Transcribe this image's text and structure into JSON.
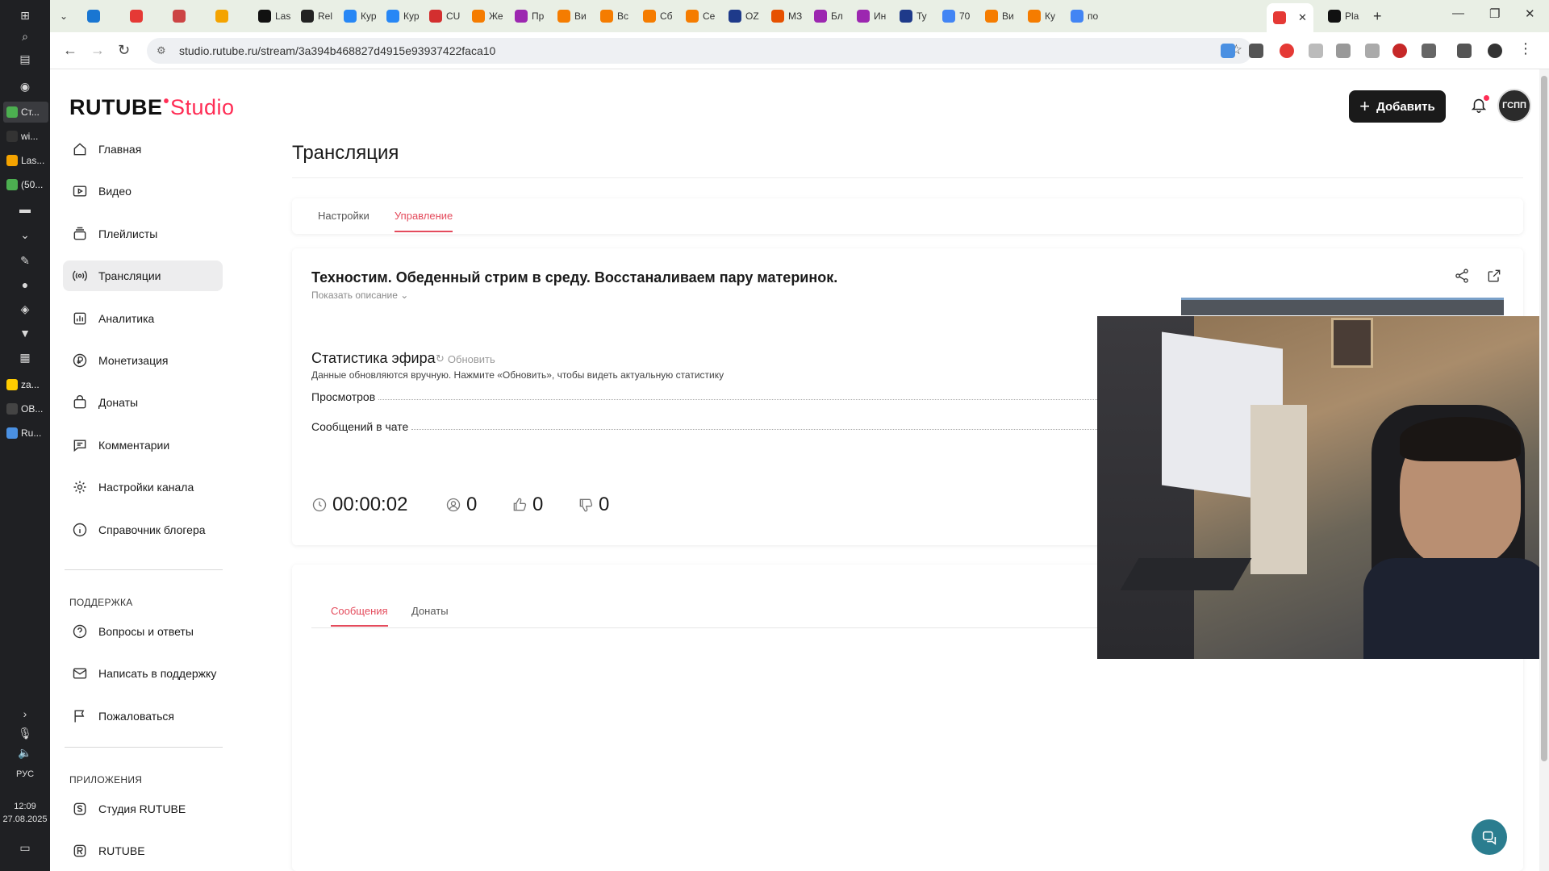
{
  "browser": {
    "tabs": [
      {
        "label": "",
        "color": "#1976d2"
      },
      {
        "label": "",
        "color": "#e53935"
      },
      {
        "label": "",
        "color": "#cc4444"
      },
      {
        "label": "",
        "color": "#f4a300"
      },
      {
        "label": "Las",
        "color": "#111111"
      },
      {
        "label": "Rel",
        "color": "#222222"
      },
      {
        "label": "Кур",
        "color": "#2787f5"
      },
      {
        "label": "Кур",
        "color": "#2787f5"
      },
      {
        "label": "CU",
        "color": "#d32f2f"
      },
      {
        "label": "Же",
        "color": "#f57c00"
      },
      {
        "label": "Пр",
        "color": "#9c27b0"
      },
      {
        "label": "Ви",
        "color": "#f57c00"
      },
      {
        "label": "Вс",
        "color": "#f57c00"
      },
      {
        "label": "Сб",
        "color": "#f57c00"
      },
      {
        "label": "Се",
        "color": "#f57c00"
      },
      {
        "label": "OZ",
        "color": "#1e3a8a"
      },
      {
        "label": "МЗ",
        "color": "#e65100"
      },
      {
        "label": "Бл",
        "color": "#9c27b0"
      },
      {
        "label": "Ин",
        "color": "#9c27b0"
      },
      {
        "label": "Ту",
        "color": "#1e3a8a"
      },
      {
        "label": "70",
        "color": "#4285f4"
      },
      {
        "label": "Ви",
        "color": "#f57c00"
      },
      {
        "label": "Ку",
        "color": "#f57c00"
      },
      {
        "label": "по",
        "color": "#4285f4"
      }
    ],
    "active_tab": {
      "label": "",
      "color": "#e53935"
    },
    "last_tab": {
      "label": "Pla",
      "color": "#111111"
    },
    "url": "studio.rutube.ru/stream/3a394b468827d4915e93937422faca10"
  },
  "taskbar": {
    "apps": [
      "Ст...",
      "wi...",
      "Las...",
      "(50...",
      "za...",
      "OB...",
      "Ru..."
    ],
    "lang": "РУС",
    "time": "12:09",
    "date": "27.08.2025"
  },
  "brand": {
    "name": "RUTUBE",
    "suffix": "Studio",
    "accent": "#ff2d55"
  },
  "header": {
    "add_label": "Добавить",
    "avatar_text": "ГСПП"
  },
  "sidebar": {
    "items": [
      {
        "label": "Главная",
        "icon": "home-icon"
      },
      {
        "label": "Видео",
        "icon": "video-icon"
      },
      {
        "label": "Плейлисты",
        "icon": "playlist-icon"
      },
      {
        "label": "Трансляции",
        "icon": "broadcast-icon"
      },
      {
        "label": "Аналитика",
        "icon": "analytics-icon"
      },
      {
        "label": "Монетизация",
        "icon": "monetization-icon"
      },
      {
        "label": "Донаты",
        "icon": "donations-icon"
      },
      {
        "label": "Комментарии",
        "icon": "comments-icon"
      },
      {
        "label": "Настройки канала",
        "icon": "gear-icon"
      },
      {
        "label": "Справочник блогера",
        "icon": "info-icon"
      }
    ],
    "support_heading": "ПОДДЕРЖКА",
    "support_items": [
      {
        "label": "Вопросы и ответы",
        "icon": "question-icon"
      },
      {
        "label": "Написать в поддержку",
        "icon": "mail-icon"
      },
      {
        "label": "Пожаловаться",
        "icon": "flag-icon"
      }
    ],
    "apps_heading": "ПРИЛОЖЕНИЯ",
    "app_items": [
      {
        "label": "Студия RUTUBE",
        "icon": "studio-app-icon"
      },
      {
        "label": "RUTUBE",
        "icon": "rutube-app-icon"
      }
    ]
  },
  "page": {
    "title": "Трансляция",
    "tabs": [
      "Настройки",
      "Управление"
    ],
    "active_tab": "Управление"
  },
  "stream": {
    "title": "Техностим. Обеденный стрим в среду. Восстаналиваем пару материнок.",
    "show_description": "Показать описание",
    "stats_heading": "Статистика эфира",
    "refresh_label": "Обновить",
    "stats_note": "Данные обновляются вручную. Нажмите «Обновить», чтобы видеть актуальную статистику",
    "rows": [
      {
        "label": "Просмотров"
      },
      {
        "label": "Сообщений в чате"
      }
    ],
    "duration": "00:00:02",
    "viewers": "0",
    "likes": "0",
    "dislikes": "0"
  },
  "chat": {
    "tabs": [
      "Сообщения",
      "Донаты"
    ],
    "active_tab": "Сообщения"
  }
}
